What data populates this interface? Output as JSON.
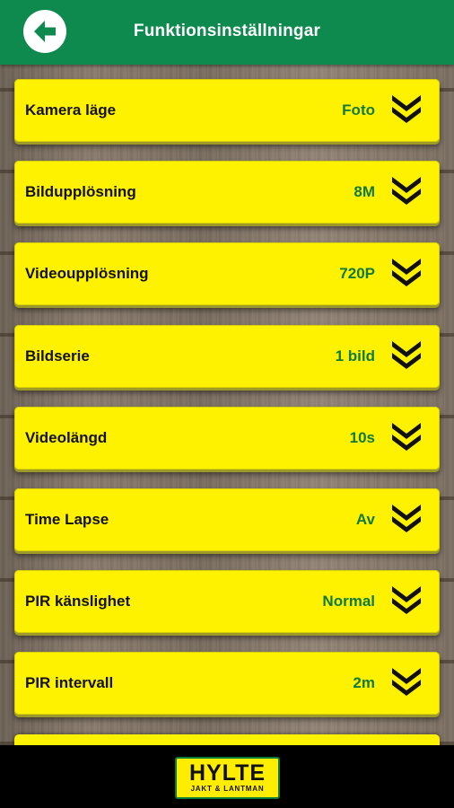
{
  "header": {
    "title": "Funktionsinställningar",
    "back_icon": "arrow-left-icon",
    "color": "#0f8a4f"
  },
  "settings": [
    {
      "label": "Kamera läge",
      "value": "Foto"
    },
    {
      "label": "Bildupplösning",
      "value": "8M"
    },
    {
      "label": "Videoupplösning",
      "value": "720P"
    },
    {
      "label": "Bildserie",
      "value": "1 bild"
    },
    {
      "label": "Videolängd",
      "value": "10s"
    },
    {
      "label": "Time Lapse",
      "value": "Av"
    },
    {
      "label": "PIR känslighet",
      "value": "Normal"
    },
    {
      "label": "PIR intervall",
      "value": "2m"
    }
  ],
  "row_icon": "double-chevron-down-icon",
  "colors": {
    "row_bg": "#fff200",
    "value_text": "#117a3a"
  },
  "footer": {
    "logo_main": "HYLTE",
    "logo_sub": "JAKT & LANTMAN"
  }
}
